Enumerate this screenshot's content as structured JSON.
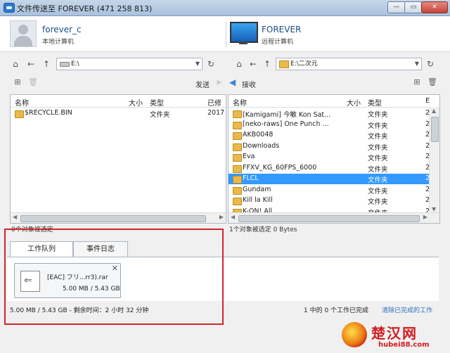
{
  "window": {
    "title": "文件传送至 FOREVER (471 258 813)",
    "min_glyph": "—",
    "max_glyph": "▭",
    "close_glyph": "✕"
  },
  "local": {
    "name": "forever_c",
    "label": "本地计算机",
    "path": "E:\\"
  },
  "remote": {
    "name": "FOREVER",
    "label": "远程计算机",
    "path": "E:\\二次元"
  },
  "actions": {
    "send": "发送",
    "receive": "接收"
  },
  "columns": {
    "name": "名称",
    "size": "大小",
    "type": "类型",
    "modified": "已修",
    "modified_short": "E"
  },
  "left_files": [
    {
      "name": "$RECYCLE.BIN",
      "type": "文件夹",
      "date": "2017"
    }
  ],
  "right_files": [
    {
      "name": "[Kamigami] 今敏 Kon Sat...",
      "type": "文件夹",
      "date": "2"
    },
    {
      "name": "[neko-raws] One Punch ...",
      "type": "文件夹",
      "date": "2"
    },
    {
      "name": "AKB0048",
      "type": "文件夹",
      "date": "2"
    },
    {
      "name": "Downloads",
      "type": "文件夹",
      "date": "2"
    },
    {
      "name": "Eva",
      "type": "文件夹",
      "date": "2"
    },
    {
      "name": "FFXV_KG_60FPS_6000",
      "type": "文件夹",
      "date": "2"
    },
    {
      "name": "FLCL",
      "type": "文件夹",
      "date": "2",
      "selected": true
    },
    {
      "name": "Gundam",
      "type": "文件夹",
      "date": "2"
    },
    {
      "name": "Kill la Kill",
      "type": "文件夹",
      "date": "2"
    },
    {
      "name": "K-ON! All",
      "type": "文件夹",
      "date": "2"
    }
  ],
  "status": {
    "left": "0个对象被选定",
    "right": "1个对象被选定  0 Bytes"
  },
  "tabs": [
    {
      "label": "工作队列"
    },
    {
      "label": "事件日志"
    }
  ],
  "job": {
    "name": "[EAC] フリ...rr3).rar",
    "size": "5.00 MB / 5.43 GB",
    "close_glyph": "✕"
  },
  "footer": {
    "progress": "5.00 MB / 5.43 GB - 剩余时间：2 小时 32 分钟",
    "jobs": "1 中的 0 个工作已完成",
    "clear": "清除已完成的工作"
  },
  "icons": {
    "home": "⌂",
    "back": "←",
    "up": "↑",
    "refresh": "↻",
    "send_arrow": "➤",
    "recv_arrow": "◀",
    "new_folder": "⊞",
    "delete": "🗑"
  },
  "watermark": {
    "text": "楚汉网",
    "url": "hubei88.com"
  },
  "colors": {
    "selected_row": "#3399ff",
    "highlight_box": "#d0262b",
    "link": "#2a6ebd"
  }
}
